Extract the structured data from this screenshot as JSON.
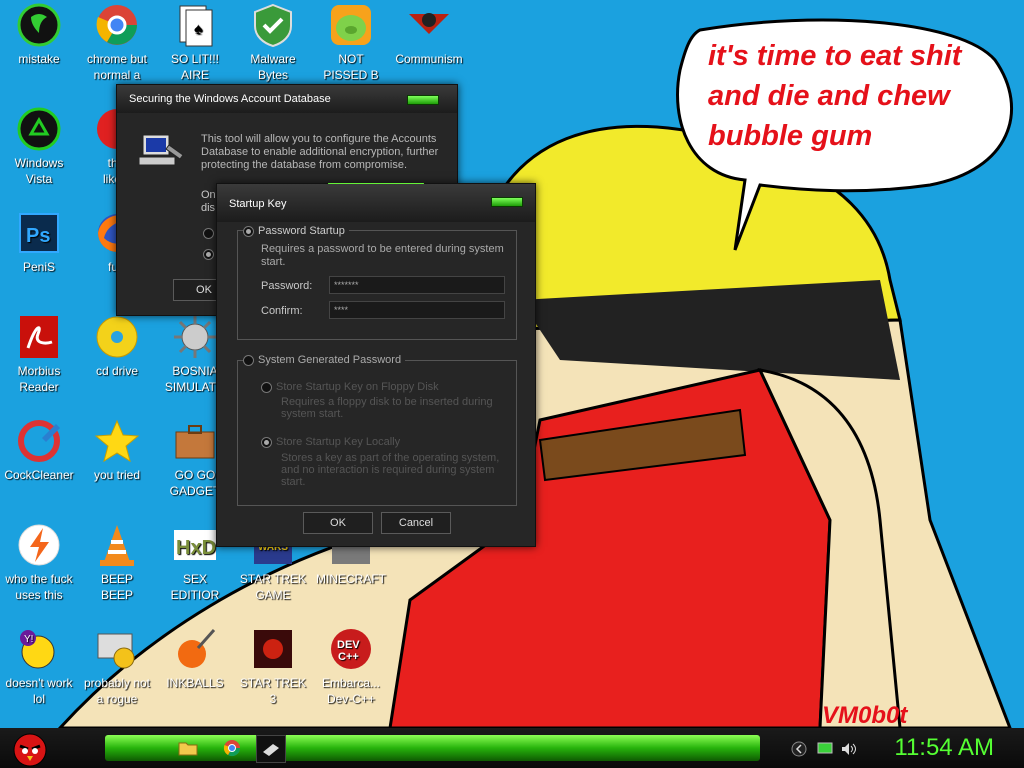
{
  "desktop": {
    "icons": [
      {
        "label": "mistake",
        "icon": "razer-logo-icon"
      },
      {
        "label": "chrome but\nnormal a",
        "icon": "chrome-icon"
      },
      {
        "label": "SO LIT!!!\nAIRE",
        "icon": "solitaire-icon"
      },
      {
        "label": "Malware\nBytes",
        "icon": "shield-check-icon"
      },
      {
        "label": "NOT\nPISSED B",
        "icon": "angry-birds-pig-icon"
      },
      {
        "label": "Communism",
        "icon": "communism-logo-icon"
      },
      {
        "label": "Windows\nVista",
        "icon": "recycle-icon"
      },
      {
        "label": "this\nlike a",
        "icon": "red-circle-icon"
      },
      {
        "label": "PeniS",
        "icon": "photoshop-icon"
      },
      {
        "label": "furr",
        "icon": "firefox-icon"
      },
      {
        "label": "Morbius\nReader",
        "icon": "acrobat-icon"
      },
      {
        "label": "cd drive",
        "icon": "cd-drive-icon"
      },
      {
        "label": "BOSNIA\nSIMULATO",
        "icon": "spiked-ball-icon"
      },
      {
        "label": "CockCleaner",
        "icon": "ccleaner-icon"
      },
      {
        "label": "you tried",
        "icon": "star-icon"
      },
      {
        "label": "GO GO\nGADGET",
        "icon": "briefcase-icon"
      },
      {
        "label": "who the fuck\nuses this",
        "icon": "lightning-icon"
      },
      {
        "label": "BEEP\nBEEP",
        "icon": "vlc-cone-icon"
      },
      {
        "label": "SEX\nEDITIOR",
        "icon": "hxd-icon"
      },
      {
        "label": "STAR TREK\nGAME",
        "icon": "star-wars-game-icon"
      },
      {
        "label": "MINECRAFT",
        "icon": "minecraft-icon"
      },
      {
        "label": "doesn't work\nlol",
        "icon": "yahoo-messenger-icon"
      },
      {
        "label": "probably not\na rogue",
        "icon": "gears-monitor-icon"
      },
      {
        "label": "INKBALLS",
        "icon": "inkball-icon"
      },
      {
        "label": "STAR TREK\n3",
        "icon": "star-wars-3-icon"
      },
      {
        "label": "Embarca...\nDev-C++",
        "icon": "dev-cpp-icon"
      }
    ],
    "speech_bubble": "it's time to eat shit\nand die and chew\nbubble gum",
    "signature": "VM0b0t"
  },
  "syskey_dialog": {
    "title": "Securing the Windows Account Database",
    "description": "This tool will allow you to configure the Accounts Database to enable additional encryption, further protecting the database from compromise.",
    "partial_text": [
      "On",
      "dis"
    ],
    "ok_label": "OK"
  },
  "startup_key_dialog": {
    "title": "Startup Key",
    "password_startup_label": "Password Startup",
    "password_startup_desc": "Requires a password to be entered during system start.",
    "password_label": "Password:",
    "password_value": "*******",
    "confirm_label": "Confirm:",
    "confirm_value": "****",
    "system_generated_label": "System Generated Password",
    "floppy_label": "Store Startup Key on Floppy Disk",
    "floppy_desc": "Requires a floppy disk to be inserted during system start.",
    "locally_label": "Store Startup Key Locally",
    "locally_desc": "Stores a key as part of the operating system, and no interaction is required during system start.",
    "ok_label": "OK",
    "cancel_label": "Cancel"
  },
  "taskbar": {
    "start_icon": "angry-bird-start-icon",
    "pinned": [
      "folder-icon",
      "chrome-icon",
      "tool-icon"
    ],
    "tray": [
      "back-icon",
      "network-icon",
      "volume-icon"
    ],
    "clock": "11:54 AM"
  }
}
